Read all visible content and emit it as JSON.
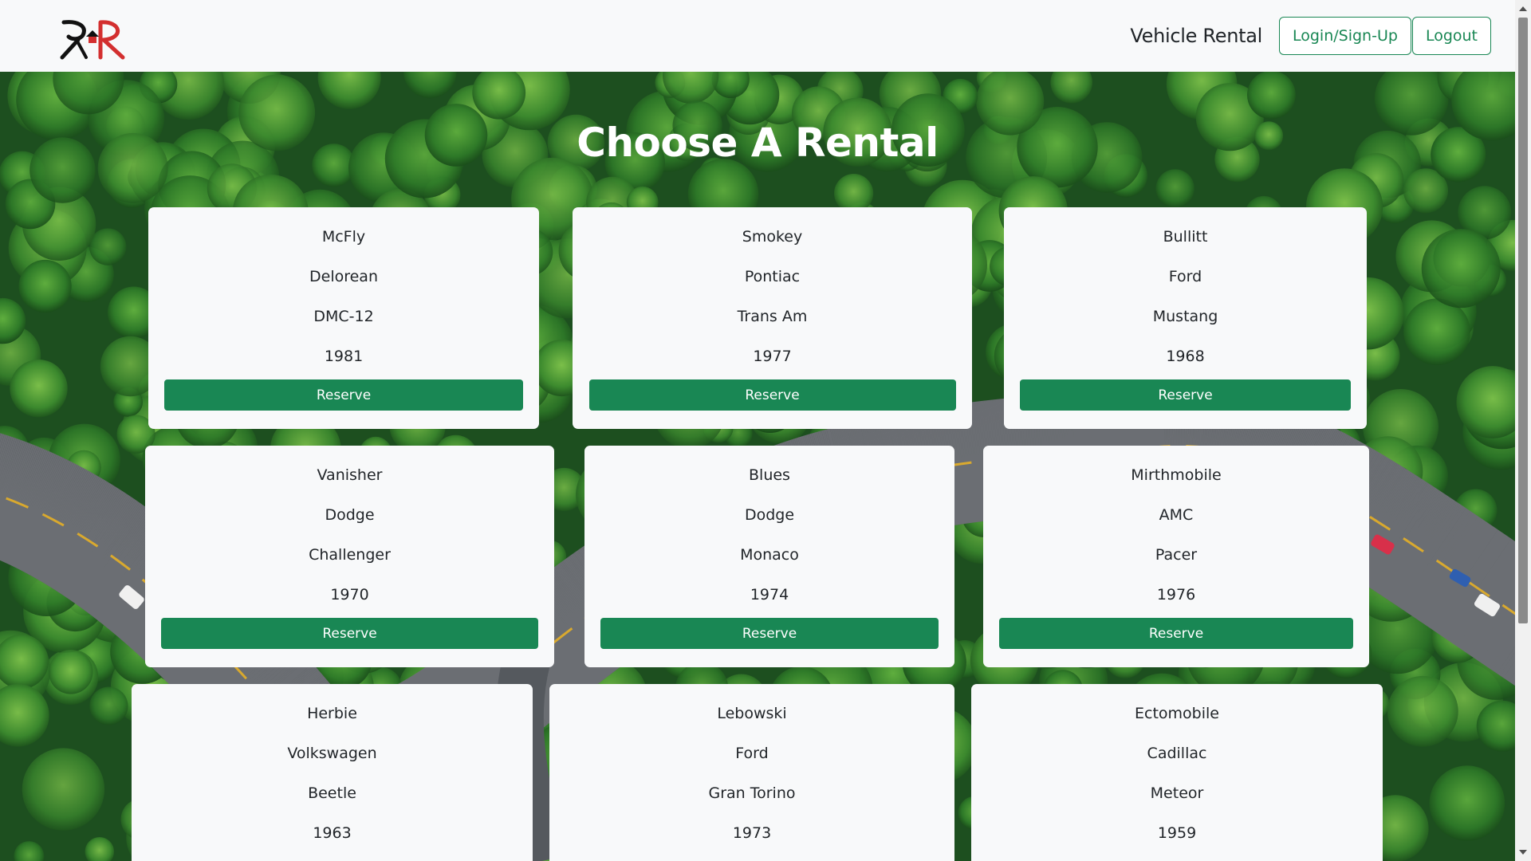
{
  "header": {
    "logo_text": "RR",
    "brand": "Vehicle Rental",
    "login_label": "Login/Sign-Up",
    "logout_label": "Logout"
  },
  "main": {
    "title": "Choose A Rental",
    "reserve_label": "Reserve",
    "cars": [
      {
        "name": "McFly",
        "make": "Delorean",
        "model": "DMC-12",
        "year": "1981"
      },
      {
        "name": "Smokey",
        "make": "Pontiac",
        "model": "Trans Am",
        "year": "1977"
      },
      {
        "name": "Bullitt",
        "make": "Ford",
        "model": "Mustang",
        "year": "1968"
      },
      {
        "name": "Vanisher",
        "make": "Dodge",
        "model": "Challenger",
        "year": "1970"
      },
      {
        "name": "Blues",
        "make": "Dodge",
        "model": "Monaco",
        "year": "1974"
      },
      {
        "name": "Mirthmobile",
        "make": "AMC",
        "model": "Pacer",
        "year": "1976"
      },
      {
        "name": "Herbie",
        "make": "Volkswagen",
        "model": "Beetle",
        "year": "1963"
      },
      {
        "name": "Lebowski",
        "make": "Ford",
        "model": "Gran Torino",
        "year": "1973"
      },
      {
        "name": "Ectomobile",
        "make": "Cadillac",
        "model": "Meteor",
        "year": "1959"
      }
    ]
  },
  "colors": {
    "accent": "#198754",
    "logo_dark": "#111111",
    "logo_red": "#d32f2f"
  }
}
